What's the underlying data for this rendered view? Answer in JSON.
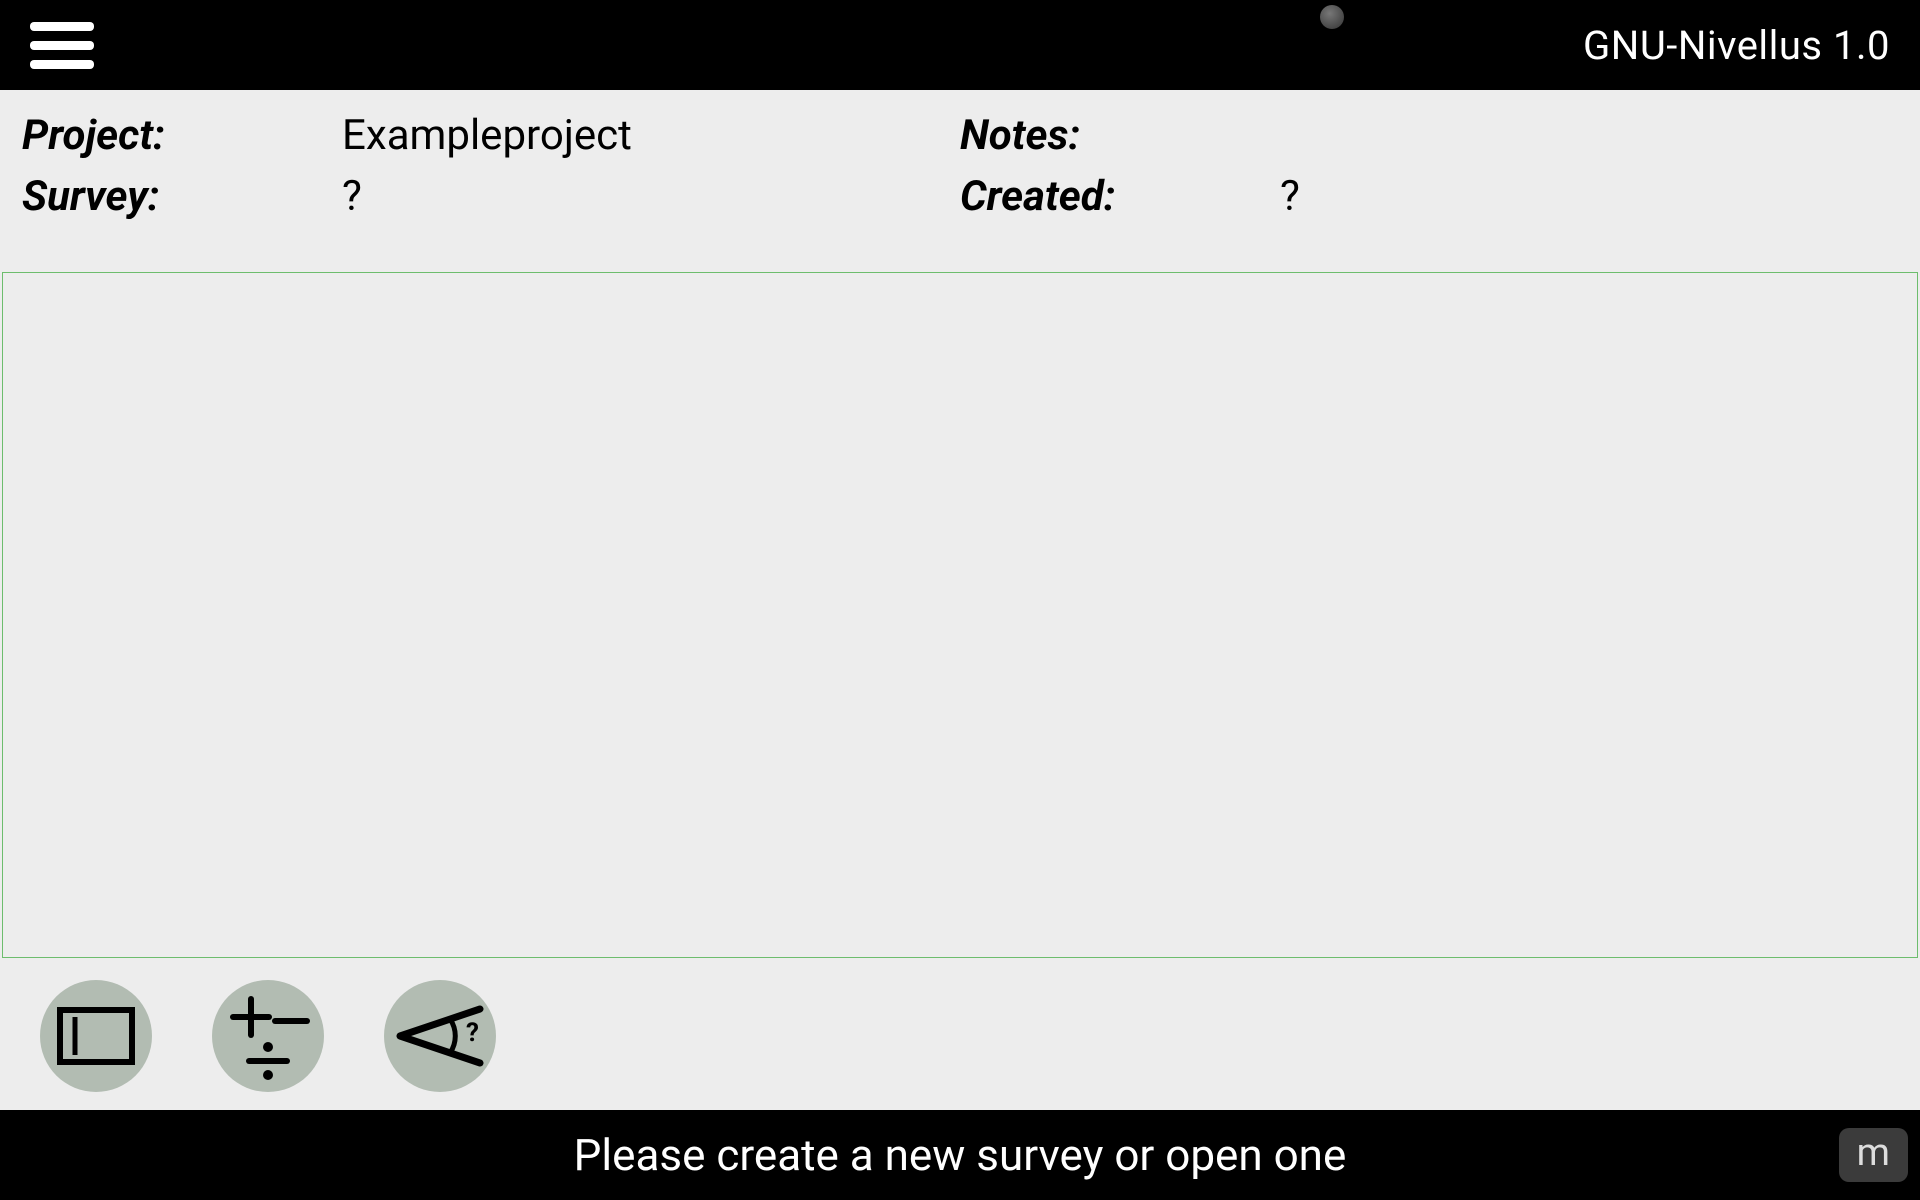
{
  "topbar": {
    "title": "GNU-Nivellus 1.0"
  },
  "info": {
    "project_label": "Project:",
    "project_value": "Exampleproject",
    "survey_label": "Survey:",
    "survey_value": "?",
    "notes_label": "Notes:",
    "notes_value": "",
    "created_label": "Created:",
    "created_value": "?"
  },
  "bottom": {
    "message": "Please create a new survey or open one",
    "unit": "m"
  },
  "tools": {
    "btn1": "view-frame",
    "btn2": "calculate",
    "btn3": "measure-angle"
  }
}
